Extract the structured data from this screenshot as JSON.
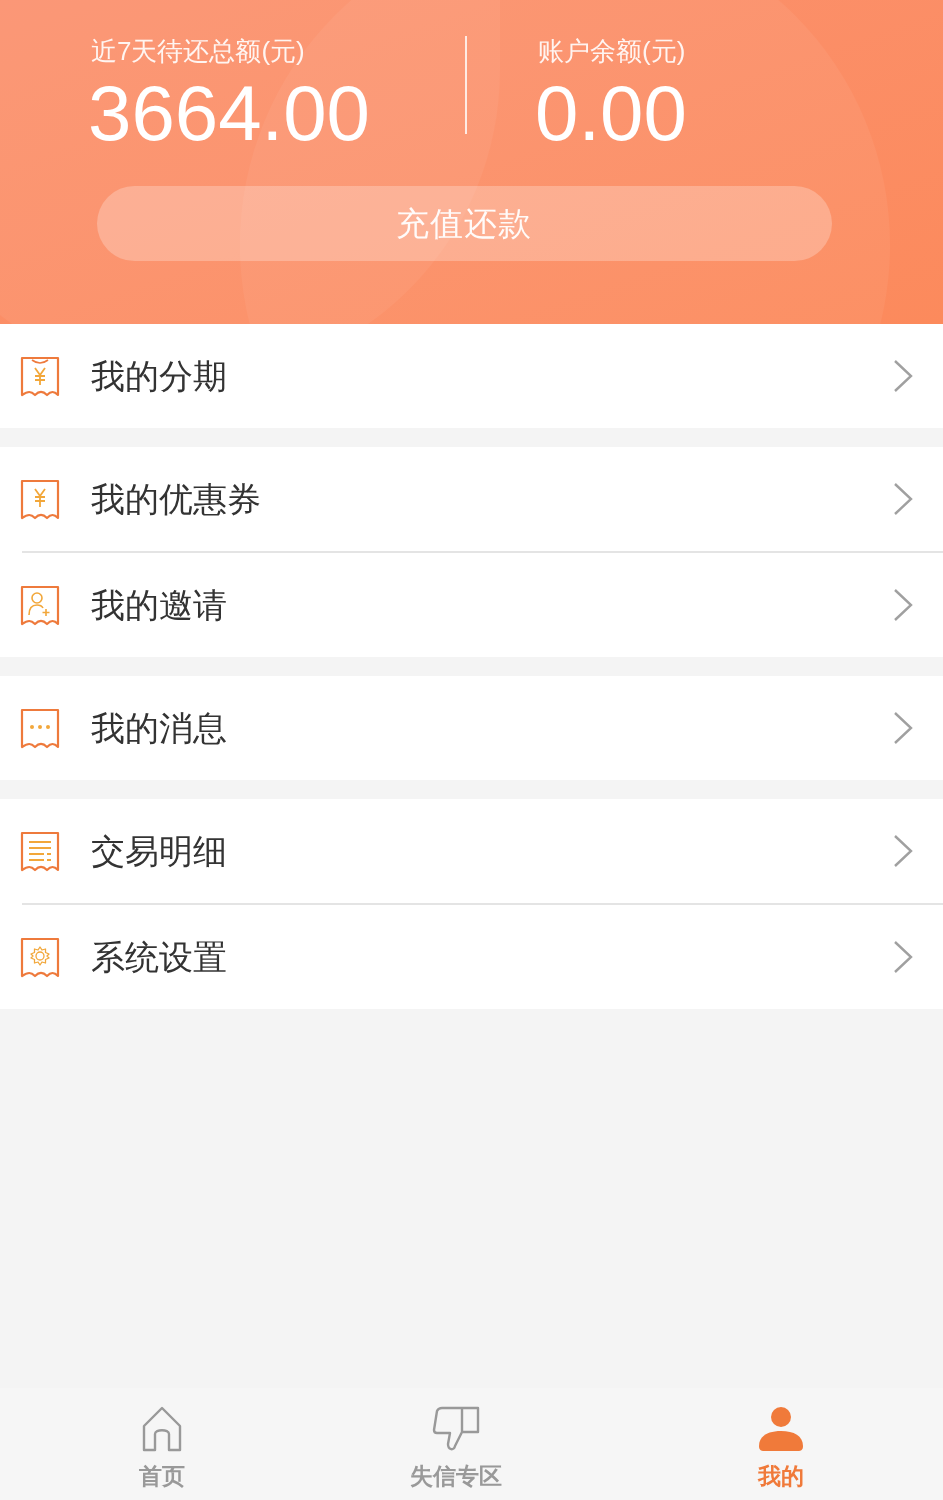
{
  "summary": [
    {
      "label": "近7天待还总额(元)",
      "amount": "3664.00"
    },
    {
      "label": "账户余额(元)",
      "amount": "0.00"
    }
  ],
  "recharge_button": "充值还款",
  "menu_groups": [
    [
      {
        "kind": "yen-top",
        "label": "我的分期"
      }
    ],
    [
      {
        "kind": "yen",
        "label": "我的优惠券"
      },
      {
        "kind": "person",
        "label": "我的邀请"
      }
    ],
    [
      {
        "kind": "dots",
        "label": "我的消息"
      }
    ],
    [
      {
        "kind": "list",
        "label": "交易明细"
      },
      {
        "kind": "gear",
        "label": "系统设置"
      }
    ]
  ],
  "tab_bar": [
    {
      "kind": "home",
      "label": "首页",
      "selected": false
    },
    {
      "kind": "thumb",
      "label": "失信专区",
      "selected": false
    },
    {
      "kind": "person",
      "label": "我的",
      "selected": true
    }
  ]
}
